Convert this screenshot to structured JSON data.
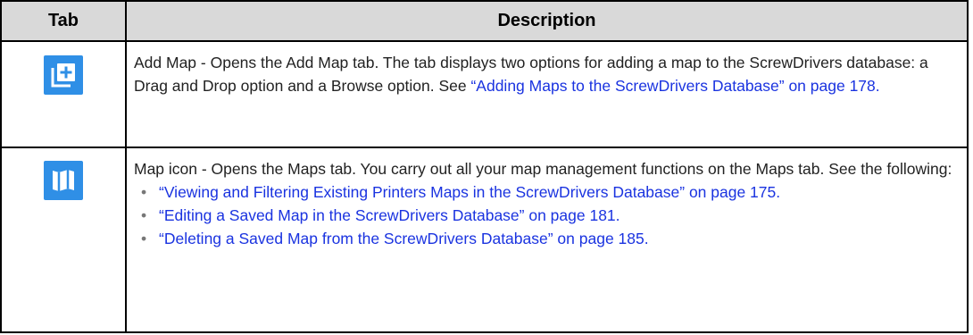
{
  "header": {
    "tab_label": "Tab",
    "description_label": "Description"
  },
  "rows": [
    {
      "icon": "add-map-icon",
      "text": "Add Map - Opens the Add Map tab. The tab displays two options for adding a map to the ScrewDrivers database: a Drag and Drop option and a Browse option. See ",
      "link": "“Adding Maps to the ScrewDrivers Database” on page 178."
    },
    {
      "icon": "map-icon",
      "text": "Map icon - Opens the Maps tab. You carry out all your map management functions on the Maps tab. See the following:",
      "bullets": [
        "“Viewing and Filtering Existing Printers Maps in the ScrewDrivers Database” on page 175.",
        "“Editing a Saved Map in the ScrewDrivers Database” on page 181.",
        "“Deleting a Saved Map from the ScrewDrivers Database” on page 185."
      ]
    }
  ],
  "colors": {
    "header_bg": "#d9d9d9",
    "icon_bg": "#2f8fe6",
    "link": "#1a33e0"
  }
}
